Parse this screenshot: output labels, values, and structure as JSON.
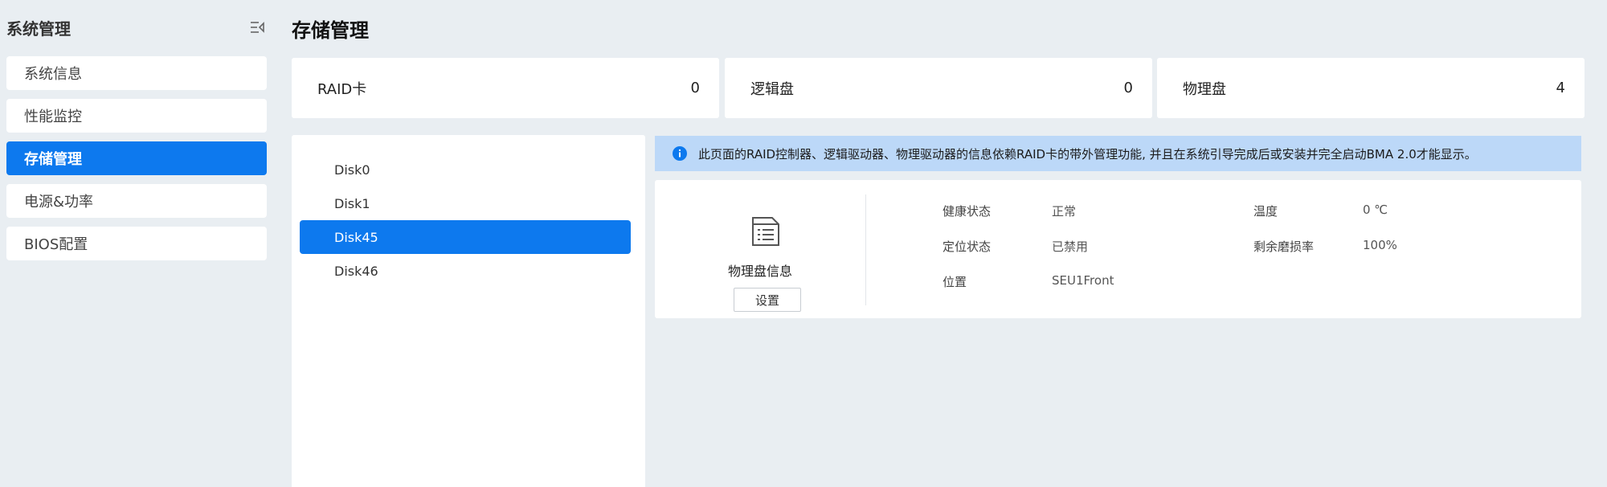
{
  "sidebar": {
    "title": "系统管理",
    "collapse_icon": "collapse-menu-icon",
    "items": [
      {
        "label": "系统信息",
        "active": false
      },
      {
        "label": "性能监控",
        "active": false
      },
      {
        "label": "存储管理",
        "active": true
      },
      {
        "label": "电源&功率",
        "active": false
      },
      {
        "label": "BIOS配置",
        "active": false
      }
    ]
  },
  "page": {
    "title": "存储管理"
  },
  "stats": [
    {
      "label": "RAID卡",
      "value": "0"
    },
    {
      "label": "逻辑盘",
      "value": "0"
    },
    {
      "label": "物理盘",
      "value": "4"
    }
  ],
  "disks": [
    {
      "label": "Disk0",
      "active": false
    },
    {
      "label": "Disk1",
      "active": false
    },
    {
      "label": "Disk45",
      "active": true
    },
    {
      "label": "Disk46",
      "active": false
    }
  ],
  "notice": {
    "icon": "info-icon",
    "text": "此页面的RAID控制器、逻辑驱动器、物理驱动器的信息依赖RAID卡的带外管理功能, 并且在系统引导完成后或安装并完全启动BMA 2.0才能显示。"
  },
  "detail": {
    "icon": "physical-disk-icon",
    "title": "物理盘信息",
    "settings_button": "设置",
    "fields": {
      "health_label": "健康状态",
      "health_value": "正常",
      "locate_label": "定位状态",
      "locate_value": "已禁用",
      "position_label": "位置",
      "position_value": "SEU1Front",
      "temp_label": "温度",
      "temp_value": "0 ℃",
      "wear_label": "剩余磨损率",
      "wear_value": "100%"
    }
  },
  "colors": {
    "accent": "#0d79ee",
    "background": "#e9eef2",
    "notice_bg": "#bcd8f8"
  }
}
